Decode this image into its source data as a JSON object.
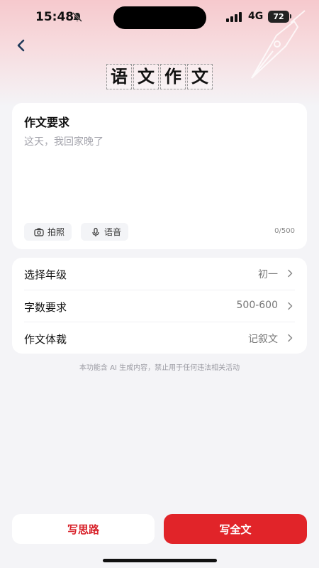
{
  "status_bar": {
    "time": "15:48",
    "network": "4G",
    "battery": "72"
  },
  "header": {
    "title_chars": [
      "语",
      "文",
      "作",
      "文"
    ]
  },
  "requirements": {
    "title": "作文要求",
    "placeholder": "这天，我回家晚了",
    "photo_label": "拍照",
    "voice_label": "语音",
    "counter": "0/500"
  },
  "settings": [
    {
      "label": "选择年级",
      "value": "初一"
    },
    {
      "label": "字数要求",
      "value": "500-600"
    },
    {
      "label": "作文体裁",
      "value": "记叙文"
    }
  ],
  "disclaimer": "本功能含 AI 生成内容，禁止用于任何违法相关活动",
  "actions": {
    "outline_label": "写思路",
    "full_label": "写全文"
  },
  "colors": {
    "accent": "#e12429",
    "header_gradient_top": "#f6c9cd",
    "background": "#f4f4f7"
  }
}
